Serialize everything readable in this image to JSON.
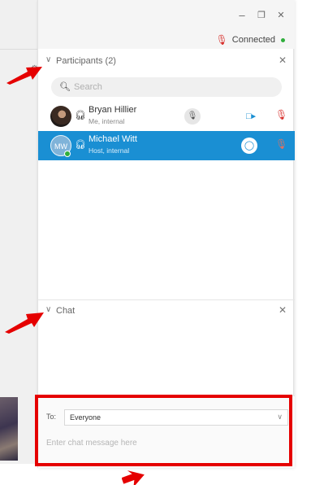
{
  "window": {
    "minimize_glyph": "–",
    "restore_glyph": "❐",
    "close_glyph": "✕"
  },
  "status": {
    "text": "Connected",
    "mic_icon": "microphone-icon",
    "indicator_color": "#2fae3c"
  },
  "participants": {
    "header": "Participants (2)",
    "search_placeholder": "Search",
    "items": [
      {
        "name": "Bryan Hillier",
        "subtitle": "Me, internal",
        "avatar": "photo",
        "selected": false
      },
      {
        "name": "Michael Witt",
        "subtitle": "Host, internal",
        "avatar_initials": "MW",
        "selected": true
      }
    ]
  },
  "chat": {
    "header": "Chat",
    "to_label": "To:",
    "to_value": "Everyone",
    "message_placeholder": "Enter chat message here"
  },
  "colors": {
    "accent": "#1a8fd3",
    "annotation": "#e50000",
    "muted": "#d8322e"
  }
}
